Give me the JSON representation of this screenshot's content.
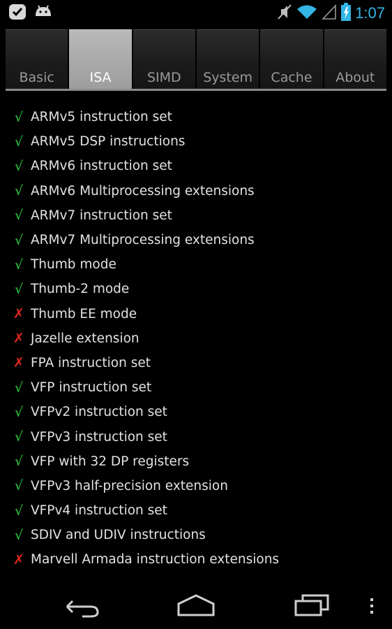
{
  "status_bar": {
    "time": "1:07",
    "icons": [
      "checkmark-notification-icon",
      "android-icon",
      "mute-icon",
      "wifi-icon",
      "signal-icon",
      "battery-charging-icon"
    ],
    "accent_color": "#33b5e5"
  },
  "tabs": [
    {
      "label": "Basic",
      "active": false
    },
    {
      "label": "ISA",
      "active": true
    },
    {
      "label": "SIMD",
      "active": false
    },
    {
      "label": "System",
      "active": false
    },
    {
      "label": "Cache",
      "active": false
    },
    {
      "label": "About",
      "active": false
    }
  ],
  "features": [
    {
      "name": "ARMv5 instruction set",
      "supported": true,
      "mark": "√"
    },
    {
      "name": "ARMv5 DSP instructions",
      "supported": true,
      "mark": "√"
    },
    {
      "name": "ARMv6 instruction set",
      "supported": true,
      "mark": "√"
    },
    {
      "name": "ARMv6 Multiprocessing extensions",
      "supported": true,
      "mark": "√"
    },
    {
      "name": "ARMv7 instruction set",
      "supported": true,
      "mark": "√"
    },
    {
      "name": "ARMv7 Multiprocessing extensions",
      "supported": true,
      "mark": "√"
    },
    {
      "name": "Thumb mode",
      "supported": true,
      "mark": "√"
    },
    {
      "name": "Thumb-2 mode",
      "supported": true,
      "mark": "√"
    },
    {
      "name": "Thumb EE mode",
      "supported": false,
      "mark": "✗"
    },
    {
      "name": "Jazelle extension",
      "supported": false,
      "mark": "✗"
    },
    {
      "name": "FPA instruction set",
      "supported": false,
      "mark": "✗"
    },
    {
      "name": "VFP instruction set",
      "supported": true,
      "mark": "√"
    },
    {
      "name": "VFPv2 instruction set",
      "supported": true,
      "mark": "√"
    },
    {
      "name": "VFPv3 instruction set",
      "supported": true,
      "mark": "√"
    },
    {
      "name": "VFP with 32 DP registers",
      "supported": true,
      "mark": "√"
    },
    {
      "name": "VFPv3 half-precision extension",
      "supported": true,
      "mark": "√"
    },
    {
      "name": "VFPv4 instruction set",
      "supported": true,
      "mark": "√"
    },
    {
      "name": "SDIV and UDIV instructions",
      "supported": true,
      "mark": "√"
    },
    {
      "name": "Marvell Armada instruction extensions",
      "supported": false,
      "mark": "✗"
    }
  ],
  "colors": {
    "supported": "#2ecc40",
    "unsupported": "#e0271f"
  },
  "nav_bar": {
    "buttons": [
      "back-icon",
      "home-icon",
      "recents-icon",
      "overflow-menu-icon"
    ]
  }
}
